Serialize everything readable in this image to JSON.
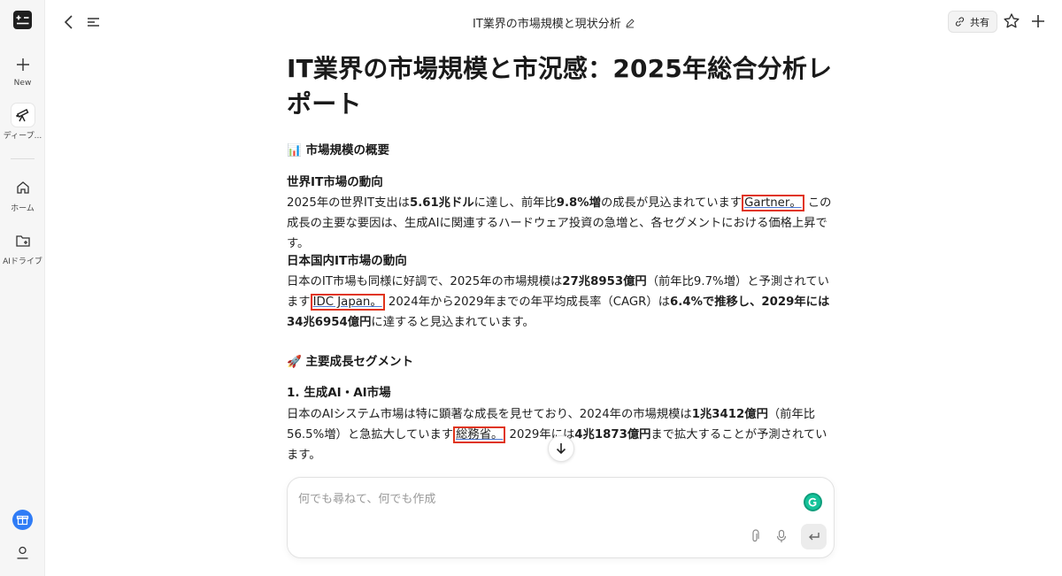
{
  "sidebar": {
    "new_label": "New",
    "deep_label": "ディープ...",
    "home_label": "ホーム",
    "drive_label": "AIドライブ"
  },
  "header": {
    "title": "IT業界の市場規模と現状分析",
    "share_label": "共有"
  },
  "article": {
    "title": "IT業界の市場規模と市況感：2025年総合分析レポート",
    "section1_icon": "📊",
    "section1": "市場規模の概要",
    "sub1": "世界IT市場の動向",
    "p1": {
      "t1": "2025年の世界IT支出は",
      "b1": "5.61兆ドル",
      "t2": "に達し、前年比",
      "b2": "9.8%増",
      "t3": "の成長が見込まれています",
      "cite": "Gartner。",
      "t4": " この成長の主要な要因は、生成AIに関連するハードウェア投資の急増と、各セグメントにおける価格上昇です。"
    },
    "sub2": "日本国内IT市場の動向",
    "p2": {
      "t1": "日本のIT市場も同様に好調で、2025年の市場規模は",
      "b1": "27兆8953億円",
      "t2": "（前年比9.7%増）と予測されています",
      "cite": "IDC Japan。",
      "t3": " 2024年から2029年までの年平均成長率（CAGR）は",
      "b2": "6.4%で推移し、2029年には34兆6954億円",
      "t4": "に達すると見込まれています。"
    },
    "section2_icon": "🚀",
    "section2": "主要成長セグメント",
    "sub3": "1. 生成AI・AI市場",
    "p3": {
      "t1": "日本のAIシステム市場は特に顕著な成長を見せており、2024年の市場規模は",
      "b1": "1兆3412億円",
      "t2": "（前年比56.5%増）と急拡大しています",
      "cite": "総務省。",
      "t3": " 2029年には",
      "b2": "4兆1873億円",
      "t4": "まで拡大することが予測されています。"
    }
  },
  "composer": {
    "placeholder": "何でも尋ねて、何でも作成"
  },
  "colors": {
    "citation_box": "#e0341a",
    "gift_badge": "#2f7cf6",
    "grammarly": "#15c39a"
  }
}
